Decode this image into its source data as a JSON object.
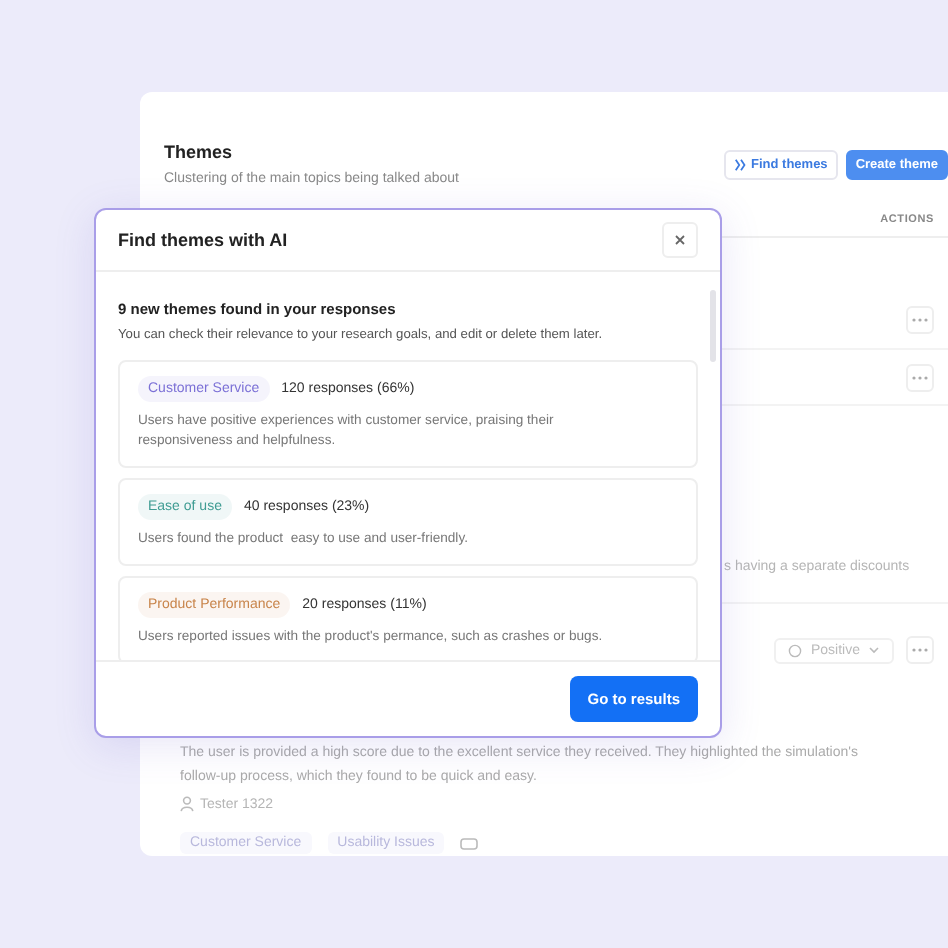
{
  "page": {
    "title": "Themes",
    "subtitle": "Clustering of the main topics being talked about",
    "buttons": [
      {
        "label": "Find themes",
        "kind": "secondary"
      },
      {
        "label": "Create theme",
        "kind": "primary"
      }
    ],
    "table": {
      "columns": [
        "ACTIONS"
      ],
      "rows": [
        {
          "kind": "actions"
        },
        {
          "kind": "actions"
        },
        {
          "kind": "text",
          "text": "s having a separate discounts"
        },
        {
          "kind": "sentiment",
          "sentiment": "Positive"
        },
        {
          "kind": "response",
          "text": "The user is provided a high score due to the excellent service they received. They highlighted the simulation's",
          "text_2": "follow-up process, which they found to be quick and easy.",
          "author": "Tester 1322",
          "tags": [
            "Customer Service",
            "Usability Issues"
          ]
        }
      ]
    }
  },
  "dialog": {
    "title": "Find themes with AI",
    "heading": "9 new themes found in your responses",
    "description": "You can check their relevance to your research goals, and edit or delete them later.",
    "themes": [
      {
        "name": "Customer Service",
        "color": "#7b70d6",
        "count": "120 responses (66%)",
        "summary": "Users have positive experiences with customer service, praising their responsiveness and helpfulness."
      },
      {
        "name": "Ease of use",
        "color": "#3f9c93",
        "count": "40 responses (23%)",
        "summary": "Users found the product  easy to use and user-friendly."
      },
      {
        "name": "Product Performance",
        "color": "#c8844a",
        "count": "20 responses (11%)",
        "summary": "Users reported issues with the product's permance, such as crashes or bugs."
      }
    ],
    "button": "Go to results"
  }
}
